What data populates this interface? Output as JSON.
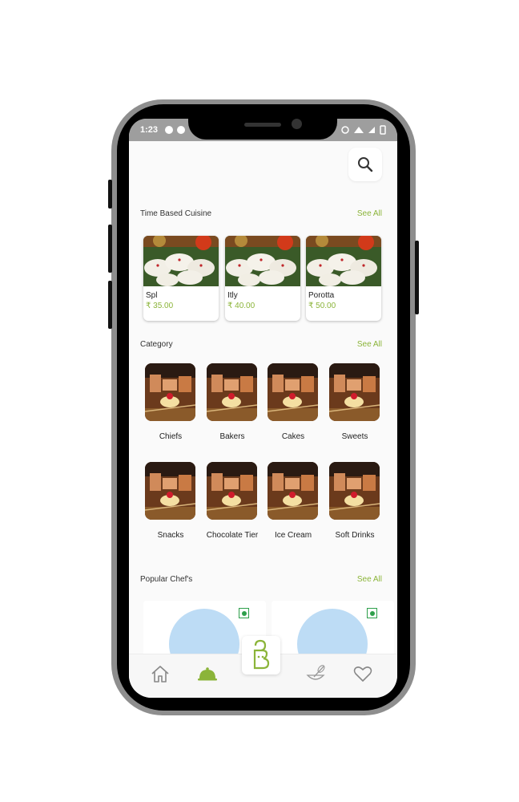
{
  "status": {
    "time": "1:23"
  },
  "header": {
    "search_icon": "search-icon"
  },
  "time_based": {
    "title": "Time Based Cuisine",
    "see_all": "See All",
    "items": [
      {
        "name": "Spl",
        "price": "₹ 35.00"
      },
      {
        "name": "Itly",
        "price": "₹ 40.00"
      },
      {
        "name": "Porotta",
        "price": "₹ 50.00"
      }
    ]
  },
  "category": {
    "title": "Category",
    "see_all": "See All",
    "items": [
      {
        "label": "Chiefs"
      },
      {
        "label": "Bakers"
      },
      {
        "label": "Cakes"
      },
      {
        "label": "Sweets"
      },
      {
        "label": "Snacks"
      },
      {
        "label": "Chocolate Tier"
      },
      {
        "label": "Ice Cream"
      },
      {
        "label": "Soft Drinks"
      }
    ]
  },
  "popular_chefs": {
    "title": "Popular Chef's",
    "see_all": "See All"
  },
  "bottom_nav": {
    "items": [
      "home-icon",
      "cloche-icon",
      "app-logo",
      "whisk-bowl-icon",
      "heart-icon"
    ],
    "accent": "#8bb439"
  },
  "colors": {
    "accent": "#8bb439",
    "chef_avatar": "#bddcf5",
    "veg": "#2e9f4b"
  }
}
